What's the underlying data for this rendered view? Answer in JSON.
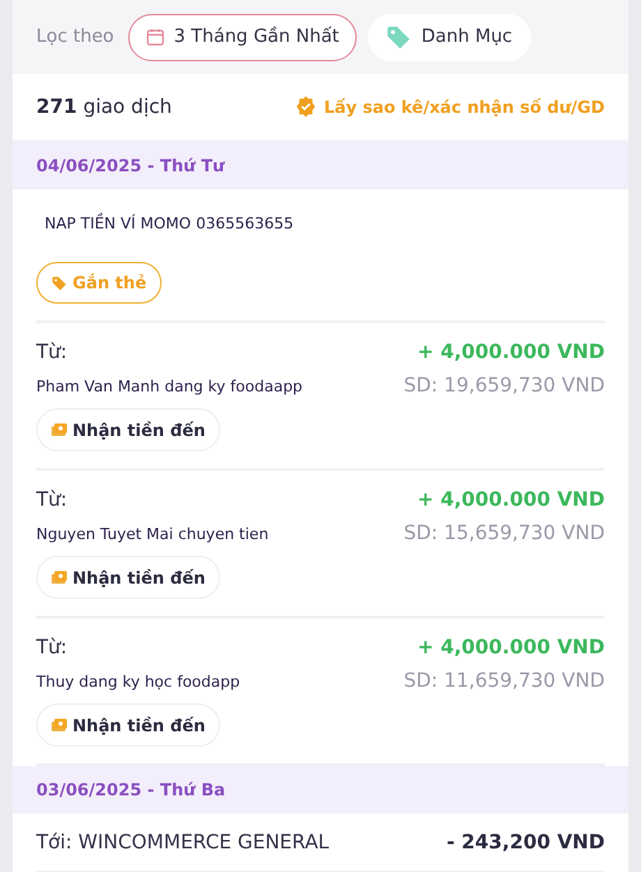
{
  "filter": {
    "label": "Lọc theo",
    "chips": [
      {
        "label": "3 Tháng Gần Nhất",
        "kind": "date",
        "selected": true
      },
      {
        "label": "Danh Mục",
        "kind": "category",
        "selected": false
      }
    ]
  },
  "summary": {
    "count": "271",
    "count_suffix": "giao dịch",
    "statement_link": "Lấy sao kê/xác nhận số dư/GD"
  },
  "groups": [
    {
      "date": "04/06/2025 - Thứ Tư",
      "items": [
        {
          "kind": "note",
          "description": "NAP TIỀN VÍ MOMO 0365563655",
          "tag_button": "Gắn thẻ"
        },
        {
          "kind": "incoming",
          "label": "Từ:",
          "description": "Pham Van Manh dang ky foodaapp",
          "amount": "+ 4,000.000 VND",
          "balance": "SD: 19,659,730 VND",
          "category": "Nhận tiền đến"
        },
        {
          "kind": "incoming",
          "label": "Từ:",
          "description": "Nguyen Tuyet Mai chuyen tien",
          "amount": "+ 4,000.000 VND",
          "balance": "SD: 15,659,730 VND",
          "category": "Nhận tiền đến"
        },
        {
          "kind": "incoming",
          "label": "Từ:",
          "description": "Thuy dang ky học foodapp",
          "amount": "+ 4,000.000 VND",
          "balance": "SD: 11,659,730 VND",
          "category": "Nhận tiền đến"
        }
      ]
    },
    {
      "date": "03/06/2025 - Thứ Ba",
      "items": [
        {
          "kind": "outgoing",
          "label": "Tới: WINCOMMERCE GENERAL",
          "amount": "- 243,200 VND"
        }
      ]
    }
  ]
}
